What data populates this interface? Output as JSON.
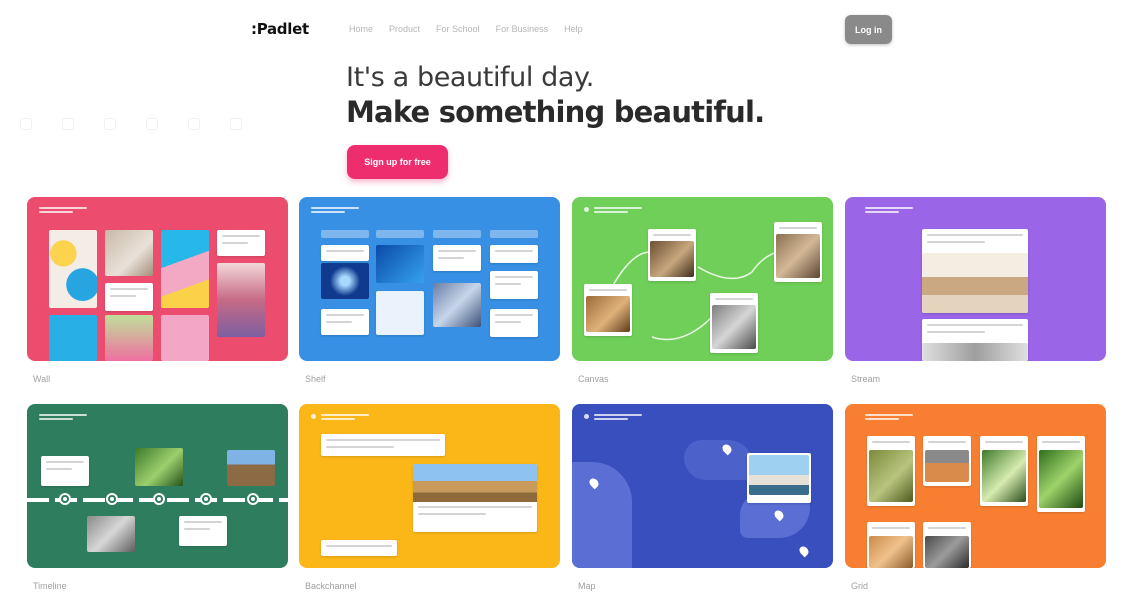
{
  "header": {
    "logo": ":Padlet",
    "nav": [
      "Home",
      "Product",
      "For School",
      "For Business",
      "Help"
    ],
    "login_label": "Log in"
  },
  "hero": {
    "line1": "It's a beautiful day.",
    "line2": "Make something beautiful.",
    "signup_label": "Sign up for free"
  },
  "cards": [
    {
      "label": "Wall",
      "color": "#ec4d6e"
    },
    {
      "label": "Shelf",
      "color": "#3790e3"
    },
    {
      "label": "Canvas",
      "color": "#6fcf58"
    },
    {
      "label": "Stream",
      "color": "#9a65e6"
    },
    {
      "label": "Timeline",
      "color": "#2e7d5f"
    },
    {
      "label": "Backchannel",
      "color": "#fbb618"
    },
    {
      "label": "Map",
      "color": "#3a4fbe"
    },
    {
      "label": "Grid",
      "color": "#f87f32"
    }
  ]
}
